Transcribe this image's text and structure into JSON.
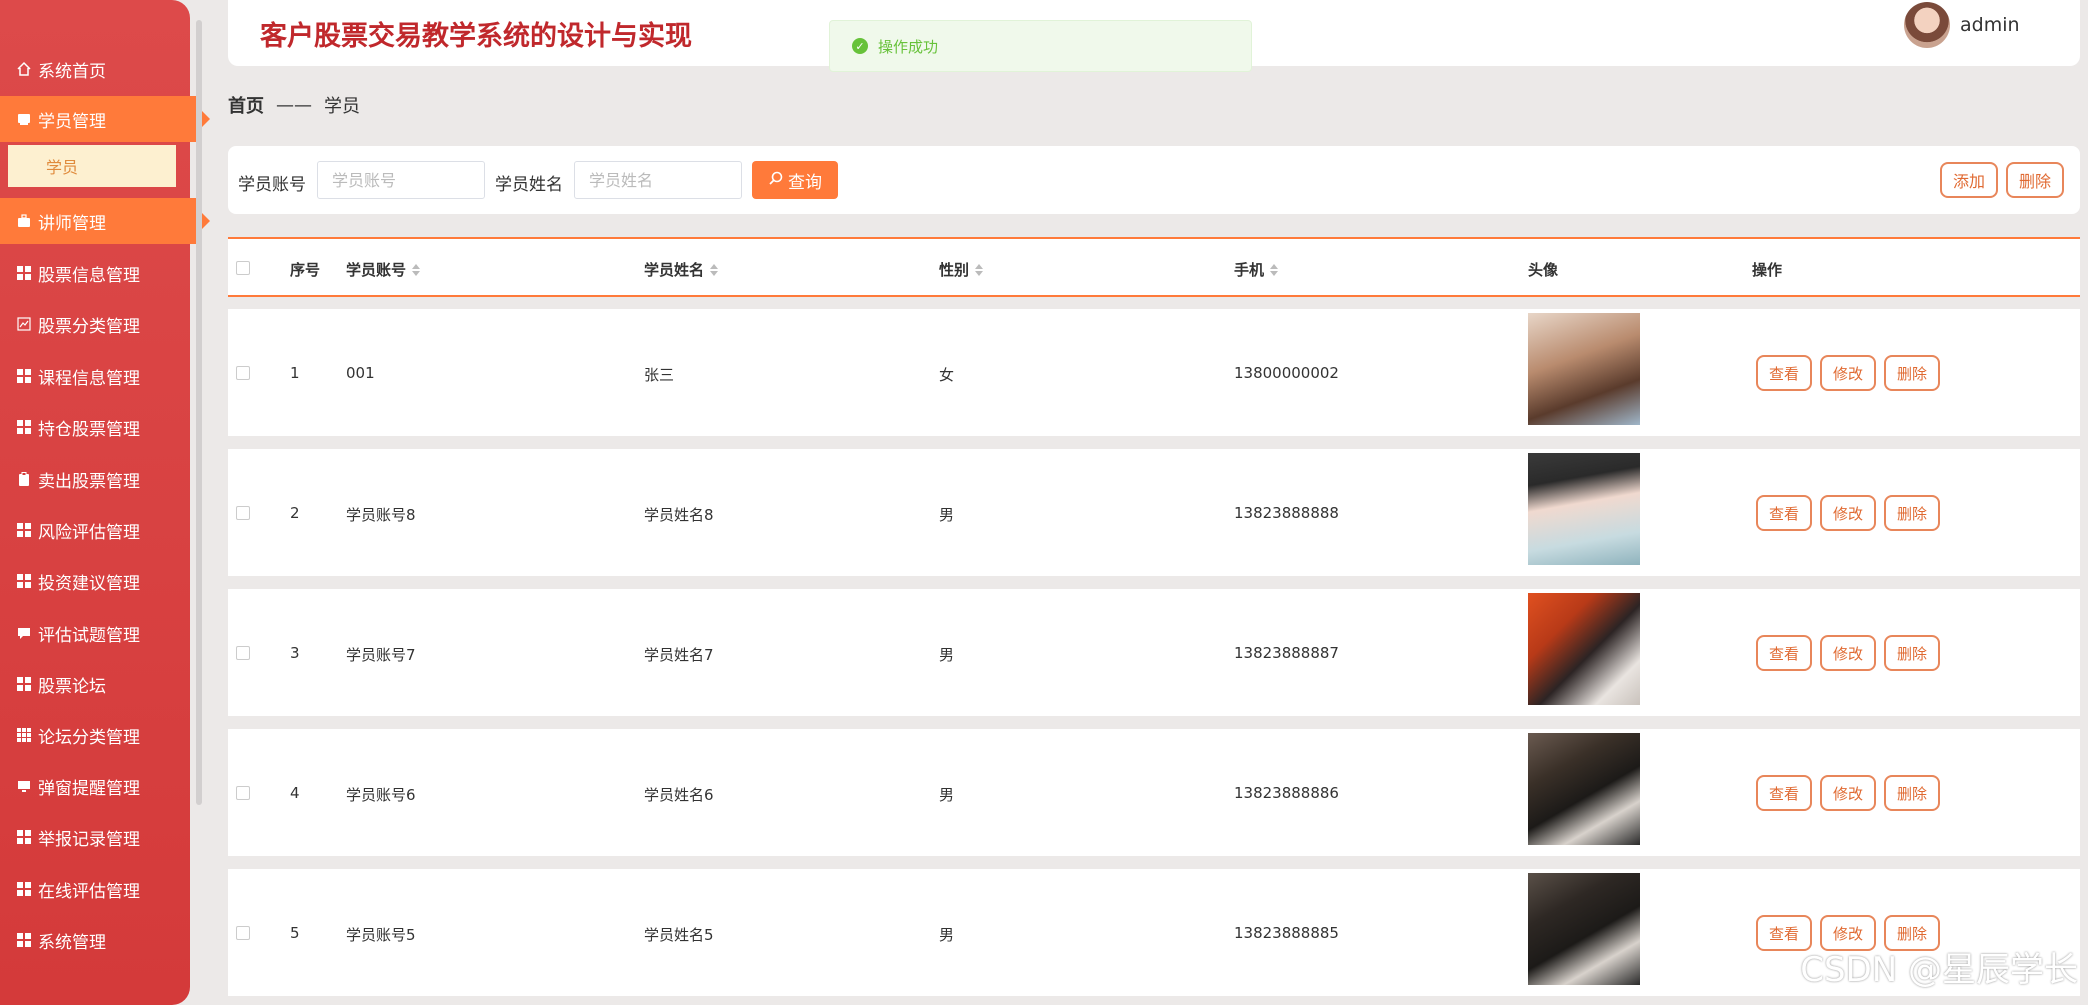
{
  "app": {
    "title": "客户股票交易教学系统的设计与实现",
    "user": "admin"
  },
  "toast": {
    "text": "操作成功"
  },
  "sidebar": {
    "items": [
      {
        "label": "系统首页",
        "icon": "home-icon"
      },
      {
        "label": "学员管理",
        "icon": "user-card-icon"
      },
      {
        "label": "讲师管理",
        "icon": "briefcase-icon"
      },
      {
        "label": "股票信息管理",
        "icon": "grid-icon"
      },
      {
        "label": "股票分类管理",
        "icon": "chart-icon"
      },
      {
        "label": "课程信息管理",
        "icon": "grid-icon"
      },
      {
        "label": "持仓股票管理",
        "icon": "grid-icon"
      },
      {
        "label": "卖出股票管理",
        "icon": "clipboard-icon"
      },
      {
        "label": "风险评估管理",
        "icon": "grid-icon"
      },
      {
        "label": "投资建议管理",
        "icon": "grid-icon"
      },
      {
        "label": "评估试题管理",
        "icon": "comment-icon"
      },
      {
        "label": "股票论坛",
        "icon": "grid-icon"
      },
      {
        "label": "论坛分类管理",
        "icon": "grid9-icon"
      },
      {
        "label": "弹窗提醒管理",
        "icon": "monitor-icon"
      },
      {
        "label": "举报记录管理",
        "icon": "grid-icon"
      },
      {
        "label": "在线评估管理",
        "icon": "grid-icon"
      },
      {
        "label": "系统管理",
        "icon": "grid-icon"
      }
    ],
    "sub_item": "学员"
  },
  "breadcrumb": {
    "home": "首页",
    "sep": "——",
    "current": "学员"
  },
  "search": {
    "account_label": "学员账号",
    "account_placeholder": "学员账号",
    "name_label": "学员姓名",
    "name_placeholder": "学员姓名",
    "query_label": "查询",
    "add_label": "添加",
    "delete_label": "删除"
  },
  "table": {
    "headers": {
      "index": "序号",
      "account": "学员账号",
      "name": "学员姓名",
      "gender": "性别",
      "phone": "手机",
      "avatar": "头像",
      "actions": "操作"
    },
    "rows": [
      {
        "index": "1",
        "account": "001",
        "name": "张三",
        "gender": "女",
        "phone": "13800000002"
      },
      {
        "index": "2",
        "account": "学员账号8",
        "name": "学员姓名8",
        "gender": "男",
        "phone": "13823888888"
      },
      {
        "index": "3",
        "account": "学员账号7",
        "name": "学员姓名7",
        "gender": "男",
        "phone": "13823888887"
      },
      {
        "index": "4",
        "account": "学员账号6",
        "name": "学员姓名6",
        "gender": "男",
        "phone": "13823888886"
      },
      {
        "index": "5",
        "account": "学员账号5",
        "name": "学员姓名5",
        "gender": "男",
        "phone": "13823888885"
      }
    ],
    "actions": {
      "view": "查看",
      "edit": "修改",
      "delete": "删除"
    }
  },
  "watermark": "CSDN @星辰学长",
  "colors": {
    "accent": "#ff7a3a",
    "sidebar": "#d43a3a",
    "title": "#c0282c"
  }
}
